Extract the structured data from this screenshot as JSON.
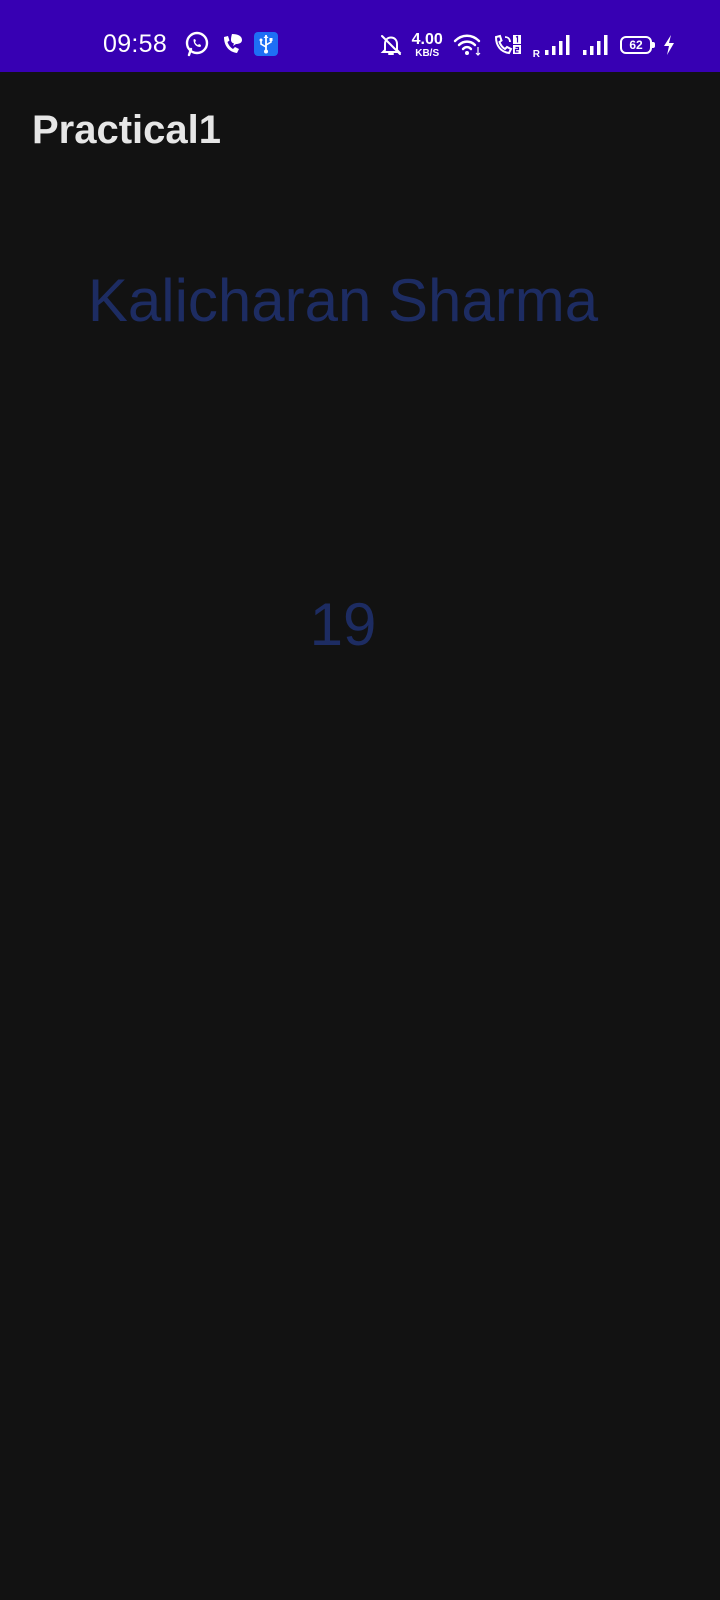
{
  "status_bar": {
    "time": "09:58",
    "network_speed_value": "4.00",
    "network_speed_unit": "KB/S",
    "signal_label": "R",
    "battery_level": "62",
    "background_color": "#3700b3",
    "icons": [
      "whatsapp-icon",
      "phone-call-icon",
      "message-icon",
      "usb-icon",
      "notifications-off-icon",
      "wifi-icon",
      "volte-call-icon",
      "signal-icon",
      "signal-icon",
      "battery-icon",
      "charging-icon"
    ]
  },
  "app_bar": {
    "title": "Practical1"
  },
  "content": {
    "name": "Kalicharan Sharma",
    "number": "19",
    "text_color": "#1d2c62"
  }
}
